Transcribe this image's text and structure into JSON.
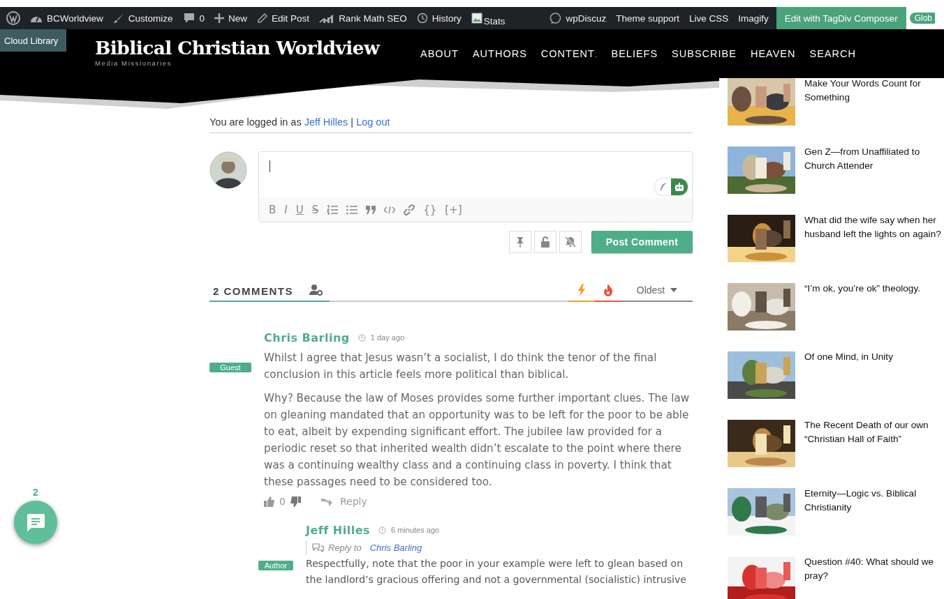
{
  "admin_bar": {
    "items": [
      {
        "kind": "wp-logo"
      },
      {
        "kind": "dashboard",
        "label": "BCWorldview"
      },
      {
        "kind": "brush",
        "label": "Customize"
      },
      {
        "kind": "comment",
        "label": "0"
      },
      {
        "kind": "plus",
        "label": "New"
      },
      {
        "kind": "pencil",
        "label": "Edit Post"
      },
      {
        "kind": "chart",
        "label": "Rank Math SEO"
      },
      {
        "kind": "clock",
        "label": "History"
      },
      {
        "kind": "broken-image",
        "label": "Stats"
      },
      {
        "kind": "discuz",
        "label": "wpDiscuz"
      },
      {
        "kind": "text",
        "label": "Theme support"
      },
      {
        "kind": "text",
        "label": "Live CSS"
      },
      {
        "kind": "text",
        "label": "Imagify"
      },
      {
        "kind": "accent",
        "label": "Edit with TagDiv Composer"
      },
      {
        "kind": "pill",
        "label": "Glob"
      }
    ]
  },
  "cloud_library": "Cloud Library",
  "site": {
    "title": "Biblical Christian Worldview",
    "tagline": "Media Missionaries"
  },
  "nav": [
    {
      "label": "ABOUT"
    },
    {
      "label": "AUTHORS"
    },
    {
      "label": "CONTENT",
      "suffix": "."
    },
    {
      "label": "BELIEFS"
    },
    {
      "label": "SUBSCRIBE"
    },
    {
      "label": "HEAVEN"
    },
    {
      "label": "SEARCH"
    }
  ],
  "login": {
    "prefix": "You are logged in as",
    "user": "Jeff Hilles",
    "separator": "|",
    "logout": "Log out"
  },
  "editor": {
    "ai_assist": {
      "on": true
    },
    "toolbar": [
      {
        "kind": "bold",
        "label": "B"
      },
      {
        "kind": "italic",
        "label": "I"
      },
      {
        "kind": "underline",
        "label": "U"
      },
      {
        "kind": "strike",
        "label": "S"
      },
      {
        "kind": "ordered-list"
      },
      {
        "kind": "bullet-list"
      },
      {
        "kind": "quote"
      },
      {
        "kind": "code"
      },
      {
        "kind": "link"
      },
      {
        "kind": "plain",
        "label": "{}"
      },
      {
        "kind": "plain",
        "label": "[+]"
      }
    ]
  },
  "actions": {
    "icons": [
      {
        "kind": "pin"
      },
      {
        "kind": "unlock"
      },
      {
        "kind": "bell-off"
      }
    ],
    "submit": "Post Comment"
  },
  "comment_tabs": {
    "count": "2 COMMENTS",
    "sort": "Oldest"
  },
  "comments": [
    {
      "author": "Chris Barling",
      "time": "1 day ago",
      "badge": "Guest",
      "paragraphs": [
        "Whilst I agree that Jesus wasn’t a socialist, I do think the tenor of the final conclusion in this article feels more political than biblical.",
        "Why? Because the law of Moses provides some further important clues. The law on gleaning mandated that an opportunity was to be left for the poor to be able to eat, albeit by expending significant effort. The jubilee law provided for a periodic reset so that inherited wealth didn’t escalate to the point where there was a continuing wealthy class and a continuing class in poverty. I think that these passages need to be considered too."
      ],
      "votes": "0",
      "reply": "Reply",
      "children": [
        {
          "author": "Jeff Hilles",
          "time": "6 minutes ago",
          "badge": "Author",
          "reply_to": {
            "label": "Reply to",
            "name": "Chris Barling"
          },
          "paragraphs": [
            "Respectfully, note that the poor in your example were left to glean based on the landlord’s gracious offering and not a governmental (socialistic) intrusive"
          ]
        }
      ]
    }
  ],
  "sidebar": {
    "items": [
      {
        "title": "Make Your Words Count for Something"
      },
      {
        "title": "Gen Z—from Unaffiliated to Church Attender"
      },
      {
        "title": "What did the wife say when her husband left the lights on again?"
      },
      {
        "title": "“I’m ok, you’re ok” theology."
      },
      {
        "title": "Of one Mind, in Unity"
      },
      {
        "title": "The Recent Death of our own “Christian Hall of Faith”"
      },
      {
        "title": "Eternity—Logic vs. Biblical Christianity"
      },
      {
        "title": "Question #40: What should we pray?"
      }
    ]
  },
  "float_button": {
    "count": "2"
  }
}
